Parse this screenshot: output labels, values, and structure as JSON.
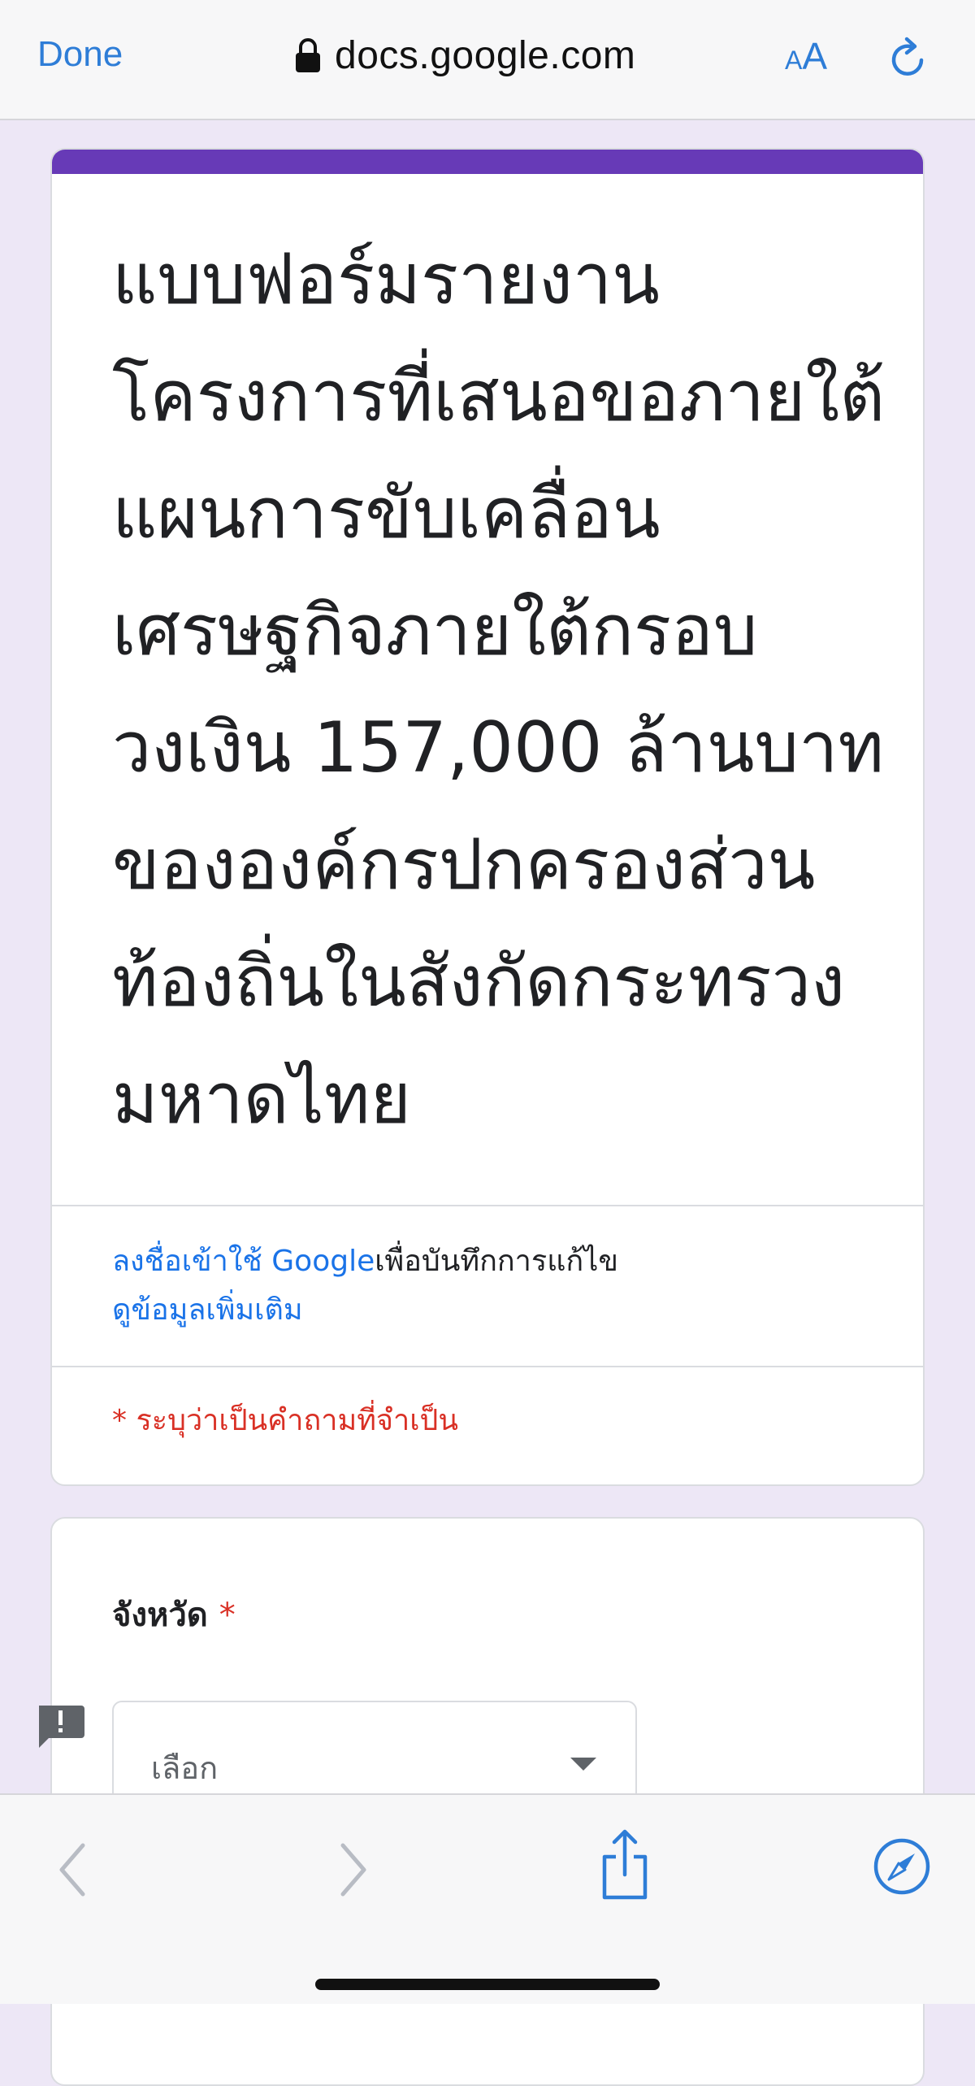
{
  "browser": {
    "done_label": "Done",
    "url": "docs.google.com",
    "text_size_small": "A",
    "text_size_large": "A"
  },
  "form": {
    "accent_color": "#673ab7",
    "title": "แบบฟอร์มรายงานโครงการที่เสนอขอภายใต้แผนการขับเคลื่อนเศรษฐกิจภายใต้กรอบวงเงิน 157,000 ล้านบาท ขององค์กรปกครองส่วนท้องถิ่นในสังกัดกระทรวงมหาดไทย",
    "signin_link": "ลงชื่อเข้าใช้ Google",
    "signin_suffix": "เพื่อบันทึกการแก้ไข",
    "more_info_link": "ดูข้อมูลเพิ่มเติม",
    "required_note": "* ระบุว่าเป็นคำถามที่จำเป็น"
  },
  "question": {
    "label": "จังหวัด",
    "required_mark": "*",
    "dropdown_value": "เลือก"
  },
  "icons": {
    "lock": "lock-icon",
    "reload": "reload-icon",
    "report": "report-problem-icon",
    "back": "chevron-left-icon",
    "forward": "chevron-right-icon",
    "share": "share-icon",
    "compass": "compass-icon"
  }
}
